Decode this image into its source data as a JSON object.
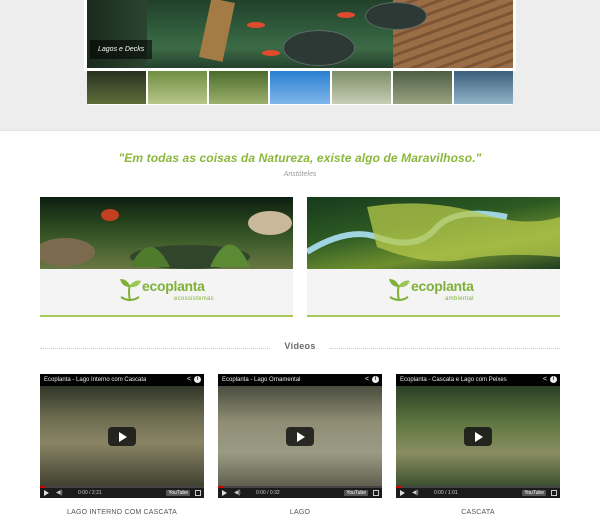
{
  "slider": {
    "caption": "Lagos e Decks",
    "thumbnails": [
      {
        "name": "thumb-lake-deck",
        "color_a": "#27321f",
        "color_b": "#5f6d3a"
      },
      {
        "name": "thumb-garden",
        "color_a": "#6f8f43",
        "color_b": "#b8c58a"
      },
      {
        "name": "thumb-trees",
        "color_a": "#4b6c2e",
        "color_b": "#9db06b"
      },
      {
        "name": "thumb-koi-fish",
        "color_a": "#2b7fd1",
        "color_b": "#7fb6ea"
      },
      {
        "name": "thumb-pond",
        "color_a": "#7d8d67",
        "color_b": "#c7cdb5"
      },
      {
        "name": "thumb-stone-path",
        "color_a": "#4d5f43",
        "color_b": "#9aa283"
      },
      {
        "name": "thumb-pond-plants",
        "color_a": "#3c5f7a",
        "color_b": "#91b3c9"
      }
    ]
  },
  "quote": {
    "text": "\"Em todas as coisas da Natureza, existe algo de Maravilhoso.\"",
    "author": "Aristóteles"
  },
  "brands": [
    {
      "name": "ecoplanta",
      "subtitle": "ecossistemas"
    },
    {
      "name": "ecoplanta",
      "subtitle": "ambiental"
    }
  ],
  "videos_section": {
    "title": "Vídeos",
    "items": [
      {
        "title": "Ecoplanta - Lago Interno com Cascata",
        "time": "0:00 / 2:21",
        "caption": "LAGO INTERNO COM CASCATA"
      },
      {
        "title": "Ecoplanta - Lago Ornamental",
        "time": "0:00 / 0:32",
        "caption": "LAGO"
      },
      {
        "title": "Ecoplanta - Cascata e Lago com Peixes",
        "time": "0:00 / 1:01",
        "caption": "CASCATA"
      }
    ],
    "player_brand": "YouTube"
  },
  "colors": {
    "accent_green": "#8ab83a",
    "card_border": "#a6c95a"
  }
}
